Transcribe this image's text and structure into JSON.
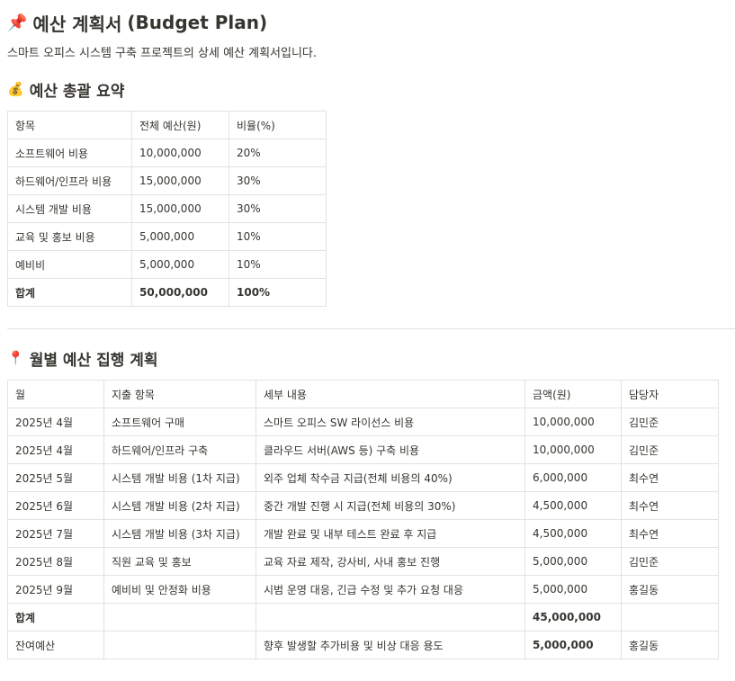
{
  "page": {
    "title_icon": "pushpin-icon",
    "title_ko": "예산 계획서",
    "title_en": "(Budget Plan)",
    "description": "스마트 오피스 시스템 구축 프로젝트의 상세 예산 계획서입니다."
  },
  "summary": {
    "icon": "money-bag-icon",
    "heading": "예산 총괄 요약",
    "headers": [
      "항목",
      "전체 예산(원)",
      "비율(%)"
    ],
    "rows": [
      [
        "소프트웨어 비용",
        "10,000,000",
        "20%"
      ],
      [
        "하드웨어/인프라 비용",
        "15,000,000",
        "30%"
      ],
      [
        "시스템 개발 비용",
        "15,000,000",
        "30%"
      ],
      [
        "교육 및 홍보 비용",
        "5,000,000",
        "10%"
      ],
      [
        "예비비",
        "5,000,000",
        "10%"
      ]
    ],
    "total": [
      "합계",
      "50,000,000",
      "100%"
    ]
  },
  "monthly": {
    "icon": "round-pushpin-icon",
    "heading": "월별 예산 집행 계획",
    "headers": [
      "월",
      "지출 항목",
      "세부 내용",
      "금액(원)",
      "담당자"
    ],
    "rows": [
      [
        "2025년 4월",
        "소프트웨어 구매",
        "스마트 오피스 SW 라이선스 비용",
        "10,000,000",
        "김민준"
      ],
      [
        "2025년 4월",
        "하드웨어/인프라 구축",
        "클라우드 서버(AWS 등) 구축 비용",
        "10,000,000",
        "김민준"
      ],
      [
        "2025년 5월",
        "시스템 개발 비용 (1차 지급)",
        "외주 업체 착수금 지급(전체 비용의 40%)",
        "6,000,000",
        "최수연"
      ],
      [
        "2025년 6월",
        "시스템 개발 비용 (2차 지급)",
        "중간 개발 진행 시 지급(전체 비용의 30%)",
        "4,500,000",
        "최수연"
      ],
      [
        "2025년 7월",
        "시스템 개발 비용 (3차 지급)",
        "개발 완료 및 내부 테스트 완료 후 지급",
        "4,500,000",
        "최수연"
      ],
      [
        "2025년 8월",
        "직원 교육 및 홍보",
        "교육 자료 제작, 강사비, 사내 홍보 진행",
        "5,000,000",
        "김민준"
      ],
      [
        "2025년 9월",
        "예비비 및 안정화 비용",
        "시범 운영 대응, 긴급 수정 및 추가 요청 대응",
        "5,000,000",
        "홍길동"
      ]
    ],
    "total": [
      "합계",
      "",
      "",
      "45,000,000",
      ""
    ],
    "remainder": [
      "잔여예산",
      "",
      "향후 발생할 추가비용 및 비상 대응 용도",
      "5,000,000",
      "홍길동"
    ]
  }
}
